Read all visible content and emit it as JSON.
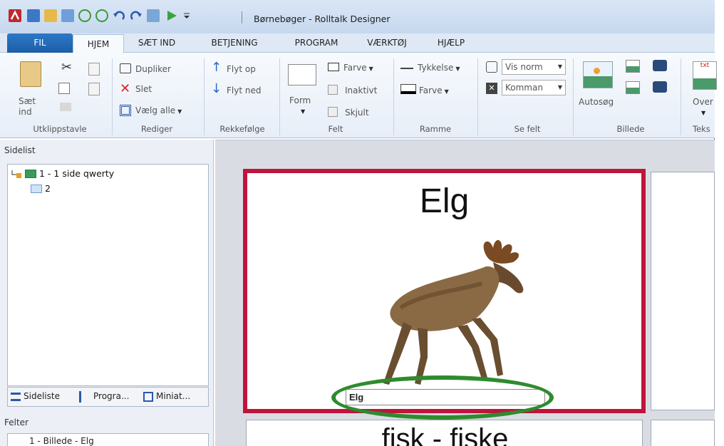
{
  "window": {
    "title": "Børnebøger - Rolltalk Designer"
  },
  "ribbon_tabs": [
    "FIL",
    "HJEM",
    "SÆT IND",
    "BETJENING",
    "PROGRAM",
    "VÆRKTØJ",
    "HJÆLP"
  ],
  "ribbon": {
    "clipboard": {
      "paste_label_1": "Sæt",
      "paste_label_2": "ind",
      "group": "Utklippstavle"
    },
    "edit": {
      "duplicate": "Dupliker",
      "delete": "Slet",
      "select_all": "Vælg alle",
      "group": "Rediger"
    },
    "order": {
      "move_up": "Flyt op",
      "move_down": "Flyt ned",
      "group": "Rekkefølge"
    },
    "field": {
      "shape": "Form",
      "color": "Farve",
      "inactive": "Inaktivt",
      "hidden": "Skjult",
      "group": "Felt"
    },
    "frame": {
      "thickness": "Tykkelse",
      "color": "Farve",
      "group": "Ramme"
    },
    "see_field": {
      "view_select": "Vis norm",
      "command_select": "Komman",
      "group": "Se felt"
    },
    "image": {
      "autosearch": "Autosøg",
      "group": "Billede"
    },
    "text": {
      "over": "Over",
      "group": "Teks",
      "icon_text": "txt"
    }
  },
  "left_panel": {
    "sidelist_title": "Sidelist",
    "tree": [
      {
        "label": "1 - 1 side qwerty"
      },
      {
        "label": "2"
      }
    ],
    "tabs": [
      "Sideliste",
      "Progra...",
      "Miniat..."
    ],
    "fields_title": "Felter",
    "fields_item": "1 - Billede - Elg"
  },
  "canvas": {
    "card_title": "Elg",
    "card_input_value": "Elg",
    "next_card_title": "fisk - fiske"
  },
  "colors": {
    "card_border": "#c0143c",
    "highlight": "#2e8b2e",
    "fil_tab": "#1c5ea8"
  }
}
